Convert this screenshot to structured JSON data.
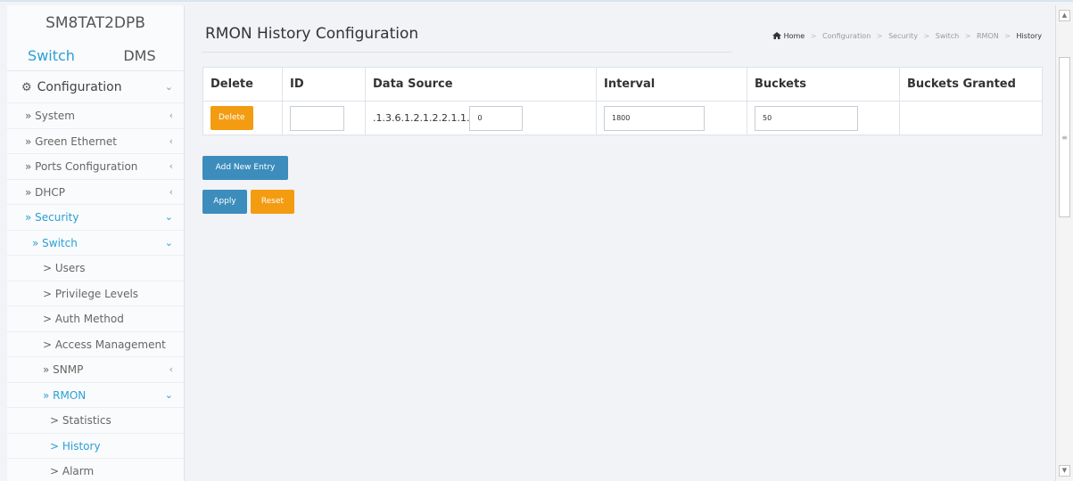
{
  "sidebar": {
    "brand": "SM8TAT2DPB",
    "modes": {
      "switch": "Switch",
      "dms": "DMS"
    },
    "items": [
      {
        "label": "Configuration",
        "level": 0,
        "chevron": "⌄"
      },
      {
        "label": "» System",
        "level": 1,
        "chevron": "‹"
      },
      {
        "label": "» Green Ethernet",
        "level": 1,
        "chevron": "‹"
      },
      {
        "label": "» Ports Configuration",
        "level": 1,
        "chevron": "‹"
      },
      {
        "label": "» DHCP",
        "level": 1,
        "chevron": "‹"
      },
      {
        "label": "» Security",
        "level": 1,
        "chevron": "⌄"
      },
      {
        "label": "» Switch",
        "level": 2,
        "chevron": "⌄"
      },
      {
        "label": "> Users",
        "level": 3,
        "chevron": ""
      },
      {
        "label": "> Privilege Levels",
        "level": 3,
        "chevron": ""
      },
      {
        "label": "> Auth Method",
        "level": 3,
        "chevron": ""
      },
      {
        "label": "> Access Management",
        "level": 3,
        "chevron": ""
      },
      {
        "label": "» SNMP",
        "level": 3,
        "chevron": "‹"
      },
      {
        "label": "» RMON",
        "level": 3,
        "chevron": "⌄"
      },
      {
        "label": "> Statistics",
        "level": 4,
        "chevron": ""
      },
      {
        "label": "> History",
        "level": 4,
        "chevron": ""
      },
      {
        "label": "> Alarm",
        "level": 4,
        "chevron": ""
      }
    ]
  },
  "main": {
    "title": "RMON History Configuration",
    "breadcrumb": {
      "home": "Home",
      "items": [
        "Configuration",
        "Security",
        "Switch",
        "RMON"
      ],
      "current": "History"
    },
    "table": {
      "headers": [
        "Delete",
        "ID",
        "Data Source",
        "Interval",
        "Buckets",
        "Buckets Granted"
      ],
      "row": {
        "delete_label": "Delete",
        "id": "",
        "data_source_prefix": ".1.3.6.1.2.1.2.2.1.1.",
        "data_source_value": "0",
        "interval": "1800",
        "buckets": "50",
        "buckets_granted": ""
      }
    },
    "buttons": {
      "add_new_entry": "Add New Entry",
      "apply": "Apply",
      "reset": "Reset"
    }
  },
  "colors": {
    "accent_blue": "#2a9fd6",
    "button_blue": "#3c8dbc",
    "button_orange": "#f39c12"
  },
  "icons": {
    "home": "home-icon",
    "gear": "gear-icon"
  }
}
